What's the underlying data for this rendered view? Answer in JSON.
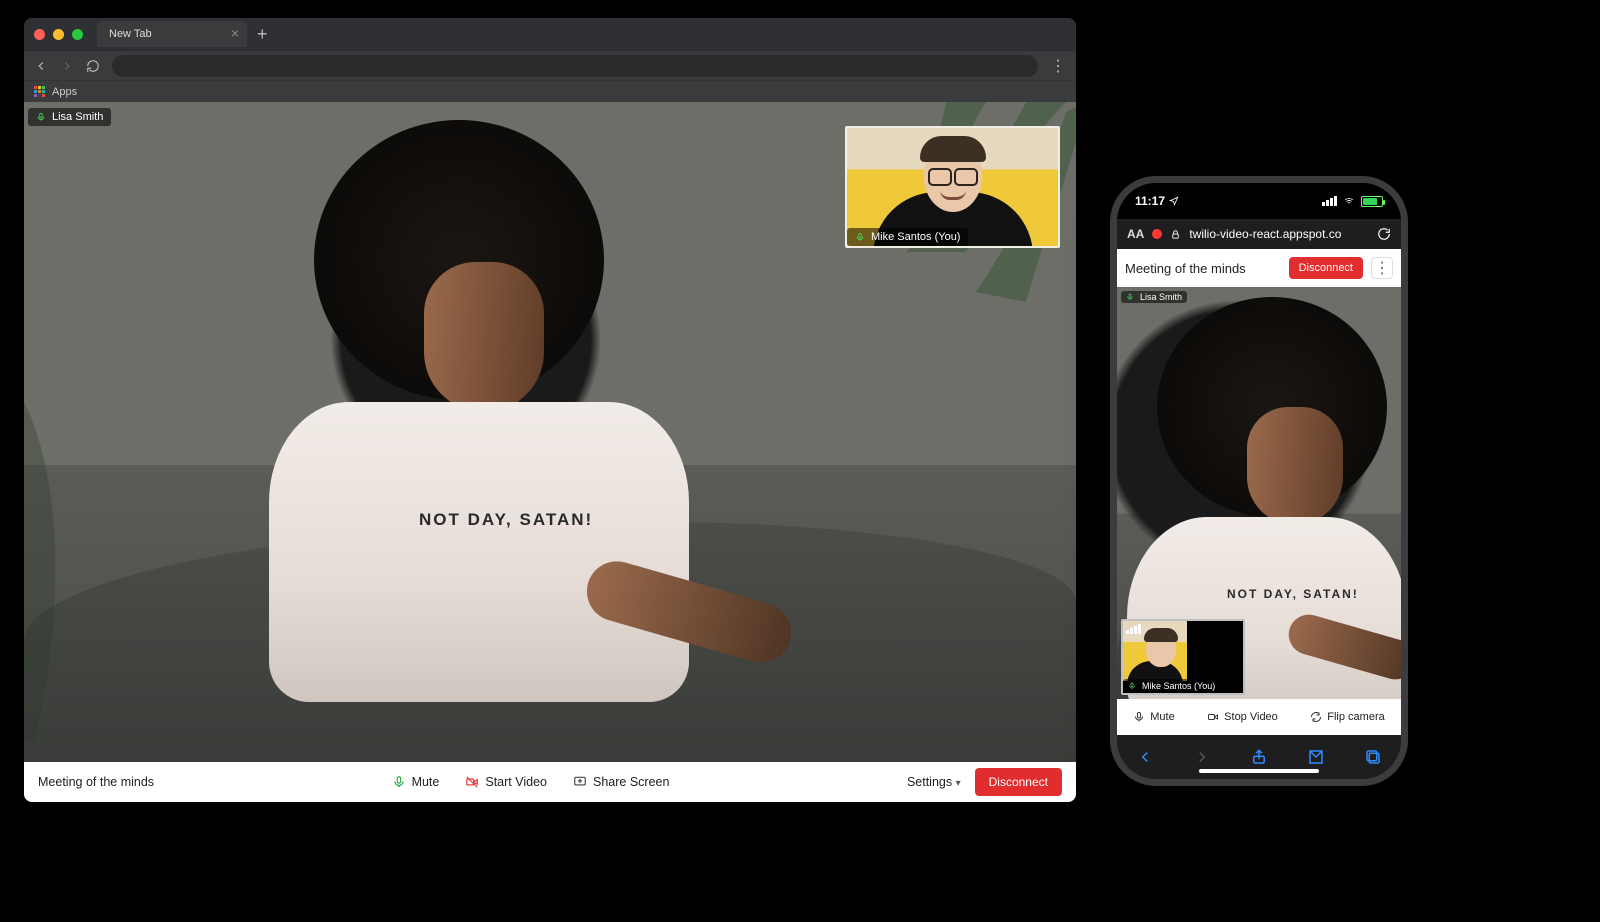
{
  "browser": {
    "tab_label": "New Tab",
    "bookmarks_apps": "Apps"
  },
  "call": {
    "remote_name": "Lisa Smith",
    "local_name": "Mike Santos (You)",
    "shirt_text": "NOT DAY, SATAN!",
    "room_name": "Meeting of the minds",
    "mute_label": "Mute",
    "start_video_label": "Start Video",
    "share_screen_label": "Share Screen",
    "settings_label": "Settings",
    "disconnect_label": "Disconnect"
  },
  "phone": {
    "status_time": "11:17",
    "url": "twilio-video-react.appspot.co",
    "room_name": "Meeting of the minds",
    "disconnect_label": "Disconnect",
    "remote_name": "Lisa Smith",
    "local_name": "Mike Santos (You)",
    "mute_label": "Mute",
    "stop_video_label": "Stop Video",
    "flip_camera_label": "Flip camera"
  }
}
